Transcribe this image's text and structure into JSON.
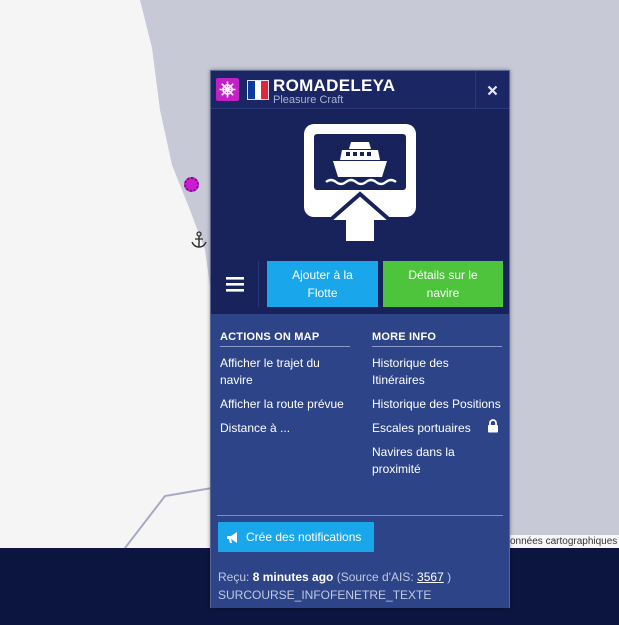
{
  "map": {
    "attribution": "onnées cartographiques"
  },
  "popup": {
    "vessel_name": "ROMADELEYA",
    "vessel_type": "Pleasure Craft",
    "flag_colors": [
      "#0b3a9e",
      "#ffffff",
      "#e0263a"
    ],
    "close_icon": "close-icon",
    "type_icon": "ship-wheel-icon",
    "buttons": {
      "fleet": "Ajouter à la Flotte",
      "details": "Détails sur le navire"
    },
    "actions": {
      "title": "ACTIONS ON MAP",
      "items": [
        "Afficher le trajet du navire",
        "Afficher la route prévue",
        "Distance à ..."
      ]
    },
    "more_info": {
      "title": "MORE INFO",
      "items": [
        "Historique des Itinéraires",
        "Historique des Positions",
        "Escales portuaires",
        "Navires dans la proximité"
      ]
    },
    "notification_button": "Crée des notifications",
    "received": {
      "prefix": "Reçu: ",
      "age": "8 minutes ago",
      "source_prefix": " (Source d'AIS: ",
      "source_id": "3567",
      "source_suffix": " )"
    },
    "surcourse": "SURCOURSE_INFOFENETRE_TEXTE"
  },
  "colors": {
    "popup_bg": "#17235a",
    "panel_bg": "#2d4488",
    "fleet_button": "#1aa6ea",
    "details_button": "#4ec33c",
    "vessel_marker": "#c81ecf"
  }
}
